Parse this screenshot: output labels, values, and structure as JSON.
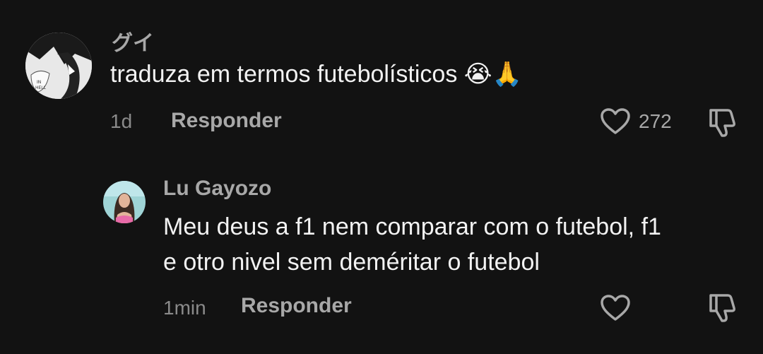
{
  "comments": [
    {
      "username": "グイ",
      "text": "traduza em termos futebolísticos",
      "emojis": "😭🙏",
      "time": "1d",
      "reply_label": "Responder",
      "likes": "272",
      "avatar_icon": "manga-avatar-icon"
    },
    {
      "username": "Lu Gayozo",
      "text_line1": "Meu deus a f1 nem comparar com o futebol, f1",
      "text_line2": "e otro nivel sem deméritar o futebol",
      "time": "1min",
      "reply_label": "Responder",
      "avatar_icon": "profile-photo-avatar"
    }
  ],
  "colors": {
    "background": "#121212",
    "text_primary": "#f2f2f2",
    "text_secondary": "#a8a8a8"
  }
}
